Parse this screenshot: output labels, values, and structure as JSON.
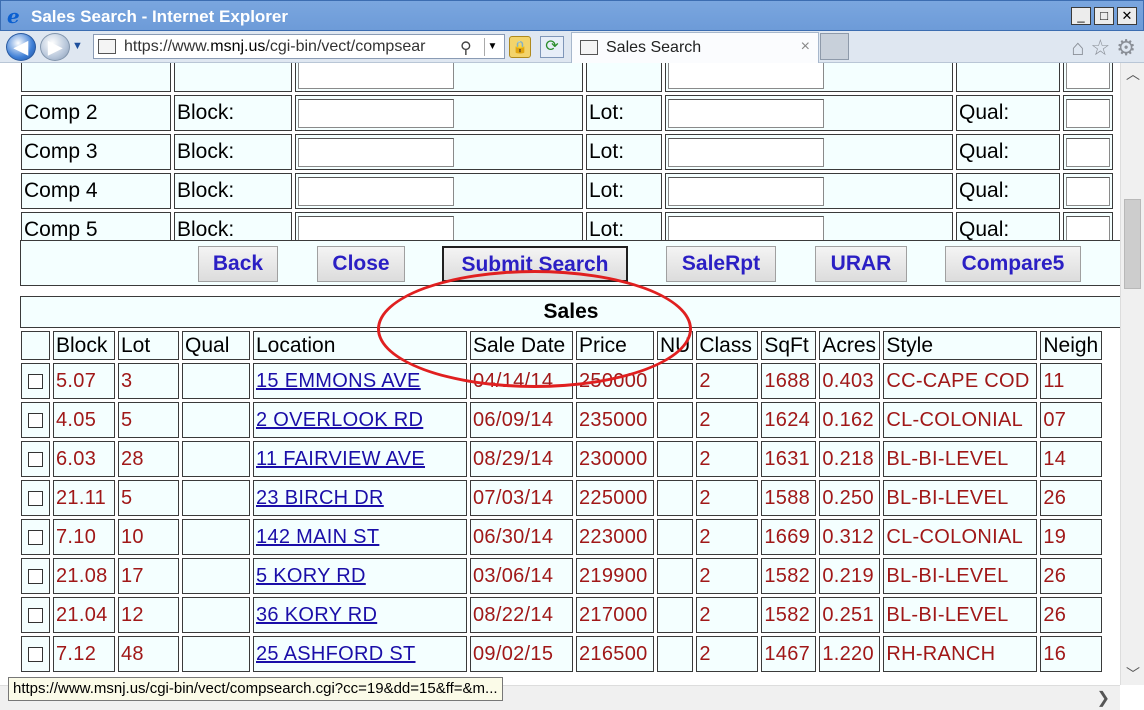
{
  "window": {
    "title": "Sales Search - Internet Explorer",
    "minimize": "_",
    "maximize": "□",
    "close": "✕"
  },
  "nav": {
    "back_icon": "back-arrow-icon",
    "forward_icon": "forward-arrow-icon",
    "url_prefix": "https://www.",
    "url_host": "msnj.us",
    "url_rest": "/cgi-bin/vect/compsear",
    "tab_label": "Sales Search",
    "tab_close": "×"
  },
  "comps": [
    {
      "label": "Comp 2",
      "block_label": "Block:",
      "lot_label": "Lot:",
      "qual_label": "Qual:"
    },
    {
      "label": "Comp 3",
      "block_label": "Block:",
      "lot_label": "Lot:",
      "qual_label": "Qual:"
    },
    {
      "label": "Comp 4",
      "block_label": "Block:",
      "lot_label": "Lot:",
      "qual_label": "Qual:"
    },
    {
      "label": "Comp 5",
      "block_label": "Block:",
      "lot_label": "Lot:",
      "qual_label": "Qual:"
    }
  ],
  "buttons": {
    "back": "Back",
    "close": "Close",
    "submit": "Submit Search",
    "salerpt": "SaleRpt",
    "urar": "URAR",
    "compare5": "Compare5"
  },
  "sales": {
    "title": "Sales",
    "columns": [
      "Block",
      "Lot",
      "Qual",
      "Location",
      "Sale Date",
      "Price",
      "NU",
      "Class",
      "SqFt",
      "Acres",
      "Style",
      "Neigh"
    ],
    "rows": [
      {
        "block": "5.07",
        "lot": "3",
        "qual": "",
        "location": "15 EMMONS AVE",
        "date": "04/14/14",
        "price": "250000",
        "nu": "",
        "class": "2",
        "sqft": "1688",
        "acres": "0.403",
        "style": "CC-CAPE COD",
        "neigh": "11"
      },
      {
        "block": "4.05",
        "lot": "5",
        "qual": "",
        "location": "2 OVERLOOK RD",
        "date": "06/09/14",
        "price": "235000",
        "nu": "",
        "class": "2",
        "sqft": "1624",
        "acres": "0.162",
        "style": "CL-COLONIAL",
        "neigh": "07"
      },
      {
        "block": "6.03",
        "lot": "28",
        "qual": "",
        "location": "11 FAIRVIEW AVE",
        "date": "08/29/14",
        "price": "230000",
        "nu": "",
        "class": "2",
        "sqft": "1631",
        "acres": "0.218",
        "style": "BL-BI-LEVEL",
        "neigh": "14"
      },
      {
        "block": "21.11",
        "lot": "5",
        "qual": "",
        "location": "23 BIRCH DR",
        "date": "07/03/14",
        "price": "225000",
        "nu": "",
        "class": "2",
        "sqft": "1588",
        "acres": "0.250",
        "style": "BL-BI-LEVEL",
        "neigh": "26"
      },
      {
        "block": "7.10",
        "lot": "10",
        "qual": "",
        "location": "142 MAIN ST",
        "date": "06/30/14",
        "price": "223000",
        "nu": "",
        "class": "2",
        "sqft": "1669",
        "acres": "0.312",
        "style": "CL-COLONIAL",
        "neigh": "19"
      },
      {
        "block": "21.08",
        "lot": "17",
        "qual": "",
        "location": "5 KORY RD",
        "date": "03/06/14",
        "price": "219900",
        "nu": "",
        "class": "2",
        "sqft": "1582",
        "acres": "0.219",
        "style": "BL-BI-LEVEL",
        "neigh": "26"
      },
      {
        "block": "21.04",
        "lot": "12",
        "qual": "",
        "location": "36 KORY RD",
        "date": "08/22/14",
        "price": "217000",
        "nu": "",
        "class": "2",
        "sqft": "1582",
        "acres": "0.251",
        "style": "BL-BI-LEVEL",
        "neigh": "26"
      },
      {
        "block": "7.12",
        "lot": "48",
        "qual": "",
        "location": "25 ASHFORD ST",
        "date": "09/02/15",
        "price": "216500",
        "nu": "",
        "class": "2",
        "sqft": "1467",
        "acres": "1.220",
        "style": "RH-RANCH",
        "neigh": "16"
      }
    ]
  },
  "status": {
    "url": "https://www.msnj.us/cgi-bin/vect/compsearch.cgi?cc=19&dd=15&ff=&m..."
  },
  "colors": {
    "cell_bg": "#f4ffff",
    "data_text": "#a01818",
    "button_text": "#2b1fc4",
    "annotation": "#e02020"
  }
}
